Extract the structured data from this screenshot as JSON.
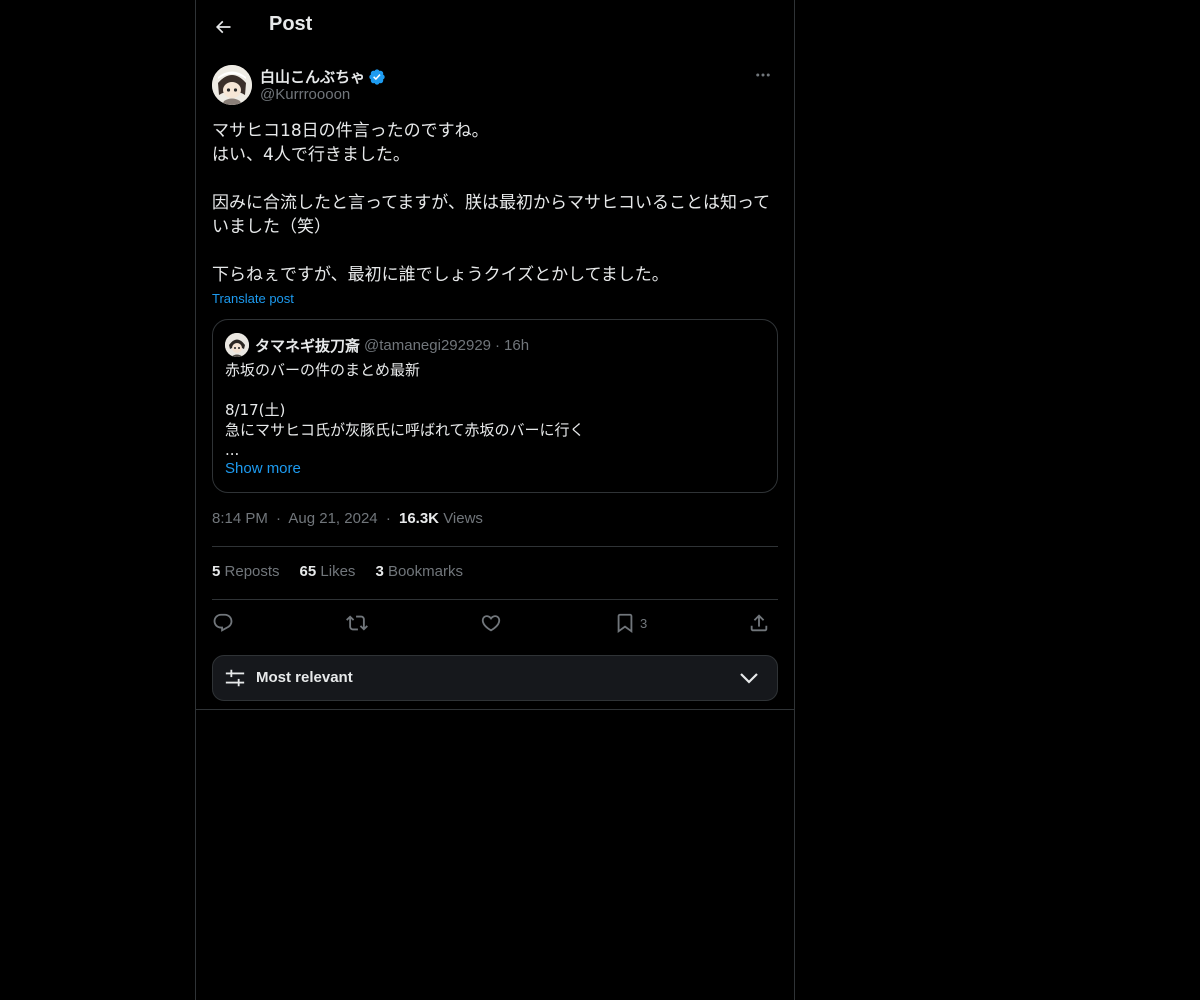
{
  "header": {
    "title": "Post",
    "back_icon": "arrow-left-icon"
  },
  "author": {
    "name": "白山こんぶちゃ",
    "handle": "@Kurrroooon",
    "verified": true
  },
  "post": {
    "text": "マサヒコ18日の件言ったのですね。\nはい、4人で行きました。\n\n因みに合流したと言ってますが、朕は最初からマサヒコいることは知っていました（笑）\n\n下らねぇですが、最初に誰でしょうクイズとかしてました。",
    "translate_label": "Translate post"
  },
  "quote": {
    "name": "タマネギ抜刀斎",
    "handle": "@tamanegi292929",
    "separator": "·",
    "time": "16h",
    "text": "赤坂のバーの件のまとめ最新\n\n8/17(土)\n急にマサヒコ氏が灰豚氏に呼ばれて赤坂のバーに行く\n...",
    "show_more": "Show more"
  },
  "meta": {
    "time": "8:14 PM",
    "sep1": "·",
    "date": "Aug 21, 2024",
    "sep2": "·",
    "views_count": "16.3K",
    "views_label": "Views"
  },
  "stats": {
    "reposts_count": "5",
    "reposts_label": "Reposts",
    "likes_count": "65",
    "likes_label": "Likes",
    "bookmarks_count": "3",
    "bookmarks_label": "Bookmarks"
  },
  "actions": {
    "reply_icon": "reply-icon",
    "repost_icon": "repost-icon",
    "like_icon": "heart-icon",
    "bookmark_icon": "bookmark-icon",
    "bookmark_count": "3",
    "share_icon": "share-icon"
  },
  "sort": {
    "label": "Most relevant"
  },
  "colors": {
    "background": "#000000",
    "text": "#e7e9ea",
    "muted": "#71767b",
    "accent": "#1d9bf0",
    "border": "#2f3336"
  }
}
